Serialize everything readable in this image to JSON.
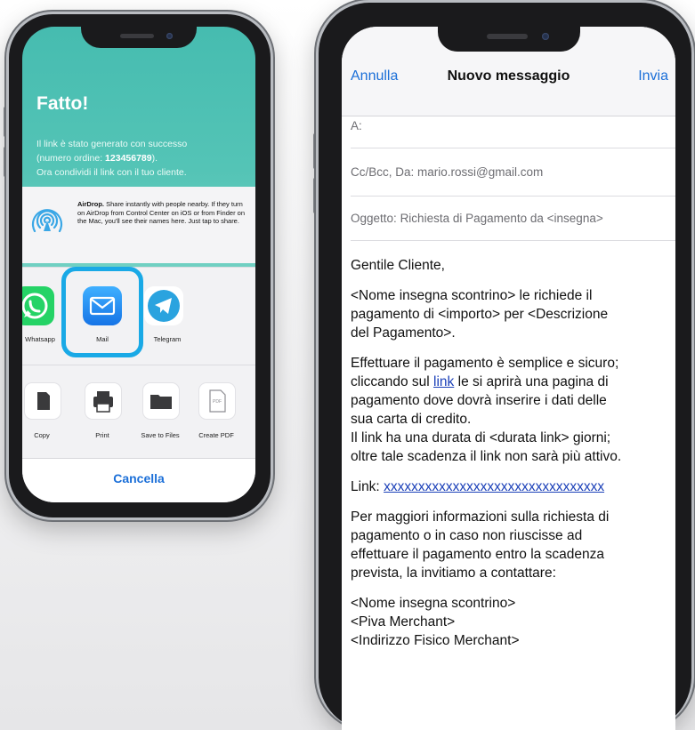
{
  "left_phone": {
    "title": "Fatto!",
    "message_line1": "Il link è stato generato con successo",
    "message_line2_prefix": "(numero ordine: ",
    "order_number": "123456789",
    "message_line2_suffix": ").",
    "message_line3": "Ora condividi il link con il tuo cliente.",
    "airdrop": {
      "title": "AirDrop.",
      "text": "Share instantly with people nearby. If they turn on AirDrop from Control Center on iOS or from Finder on the Mac, you'll see their names here. Just tap to share."
    },
    "apps": [
      {
        "label": "Whatsapp",
        "icon": "whatsapp-icon"
      },
      {
        "label": "Mail",
        "icon": "mail-icon"
      },
      {
        "label": "Telegram",
        "icon": "telegram-icon"
      }
    ],
    "actions": [
      {
        "label": "Copy",
        "icon": "copy-icon"
      },
      {
        "label": "Print",
        "icon": "printer-icon"
      },
      {
        "label": "Save to Files",
        "icon": "folder-icon"
      },
      {
        "label": "Create PDF",
        "icon": "pdf-icon"
      }
    ],
    "pdf_badge": "PDF",
    "cancel_label": "Cancella"
  },
  "right_phone": {
    "cancel": "Annulla",
    "title": "Nuovo messaggio",
    "send": "Invia",
    "to_label": "A:",
    "cc_label": "Cc/Bcc, Da:",
    "cc_value": "mario.rossi@gmail.com",
    "subject_label": "Oggetto:",
    "subject_value": "Richiesta di Pagamento da <insegna>",
    "greeting": "Gentile Cliente,",
    "para1_l1": "<Nome insegna scontrino> le richiede il",
    "para1_l2": "pagamento di <importo> per <Descrizione",
    "para1_l3": "del Pagamento>.",
    "para2_l1": "Effettuare il pagamento è semplice e sicuro;",
    "para2_l2_pre": "cliccando sul ",
    "para2_l2_link": "link",
    "para2_l2_post": " le si aprirà una pagina di",
    "para2_l3": "pagamento dove dovrà inserire i dati delle",
    "para2_l4": "sua carta di credito.",
    "para2_l5": "Il link ha una durata di <durata link> giorni;",
    "para2_l6": "oltre tale scadenza il link non sarà più attivo.",
    "link_label": "Link: ",
    "link_value": "xxxxxxxxxxxxxxxxxxxxxxxxxxxxxxxx",
    "para3_l1": "Per maggiori informazioni sulla richiesta di",
    "para3_l2": "pagamento o in caso non riuscisse ad",
    "para3_l3": "effettuare il pagamento entro la scadenza",
    "para3_l4": "prevista, la invitiamo a contattare:",
    "sig_l1": "<Nome insegna scontrino>",
    "sig_l2": "<Piva Merchant>",
    "sig_l3": "<Indirizzo Fisico Merchant>"
  },
  "colors": {
    "accent_blue": "#1b6fd8",
    "highlight": "#19a9e6",
    "teal": "#46bcb0",
    "whatsapp": "#25d366",
    "telegram": "#2aa3df",
    "mail_gradient": "#1f8ef1"
  }
}
